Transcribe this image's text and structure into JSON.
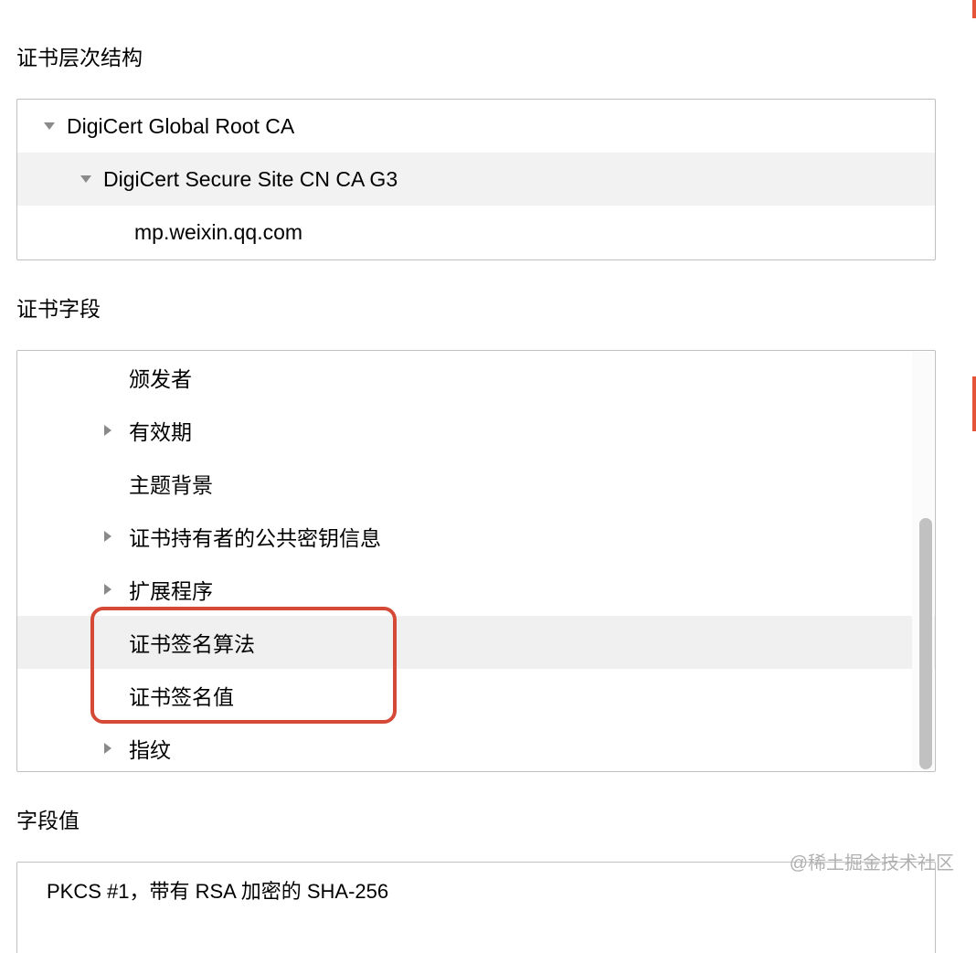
{
  "sections": {
    "hierarchy_label": "证书层次结构",
    "fields_label": "证书字段",
    "value_label": "字段值"
  },
  "hierarchy": {
    "level0": "DigiCert Global Root CA",
    "level1": "DigiCert Secure Site CN CA G3",
    "level2": "mp.weixin.qq.com"
  },
  "fields": {
    "issuer": "颁发者",
    "validity": "有效期",
    "subject": "主题背景",
    "pubkey": "证书持有者的公共密钥信息",
    "extensions": "扩展程序",
    "sig_algo": "证书签名算法",
    "sig_value": "证书签名值",
    "fingerprint": "指纹"
  },
  "value": "PKCS #1，带有 RSA 加密的 SHA-256",
  "watermark": "@稀土掘金技术社区"
}
